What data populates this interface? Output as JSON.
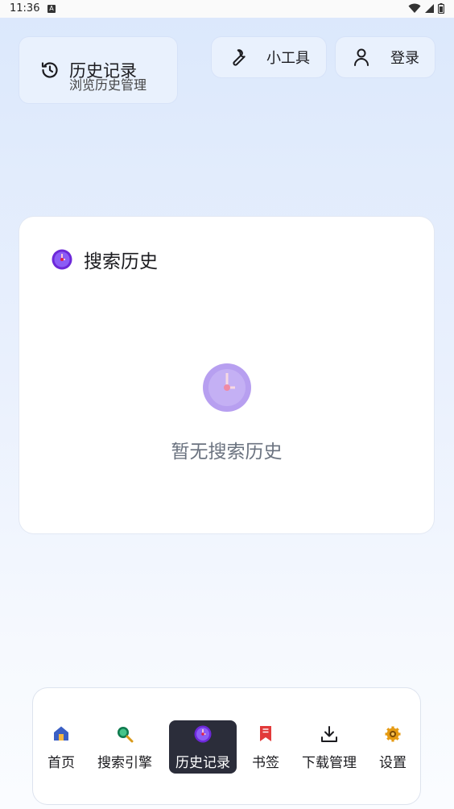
{
  "status": {
    "time": "11:36",
    "notification": "A"
  },
  "history_card": {
    "title": "历史记录",
    "subtitle": "浏览历史管理"
  },
  "tools": {
    "label": "小工具"
  },
  "login": {
    "label": "登录"
  },
  "panel": {
    "title": "搜索历史",
    "empty_text": "暂无搜索历史"
  },
  "nav": {
    "items": [
      {
        "label": "首页"
      },
      {
        "label": "搜索引擎"
      },
      {
        "label": "历史记录"
      },
      {
        "label": "书签"
      },
      {
        "label": "下载管理"
      },
      {
        "label": "设置"
      }
    ],
    "active": "历史记录"
  },
  "colors": {
    "accent": "#2b2d3a",
    "purple": "#8b5cf6",
    "muted": "#6b7380"
  }
}
